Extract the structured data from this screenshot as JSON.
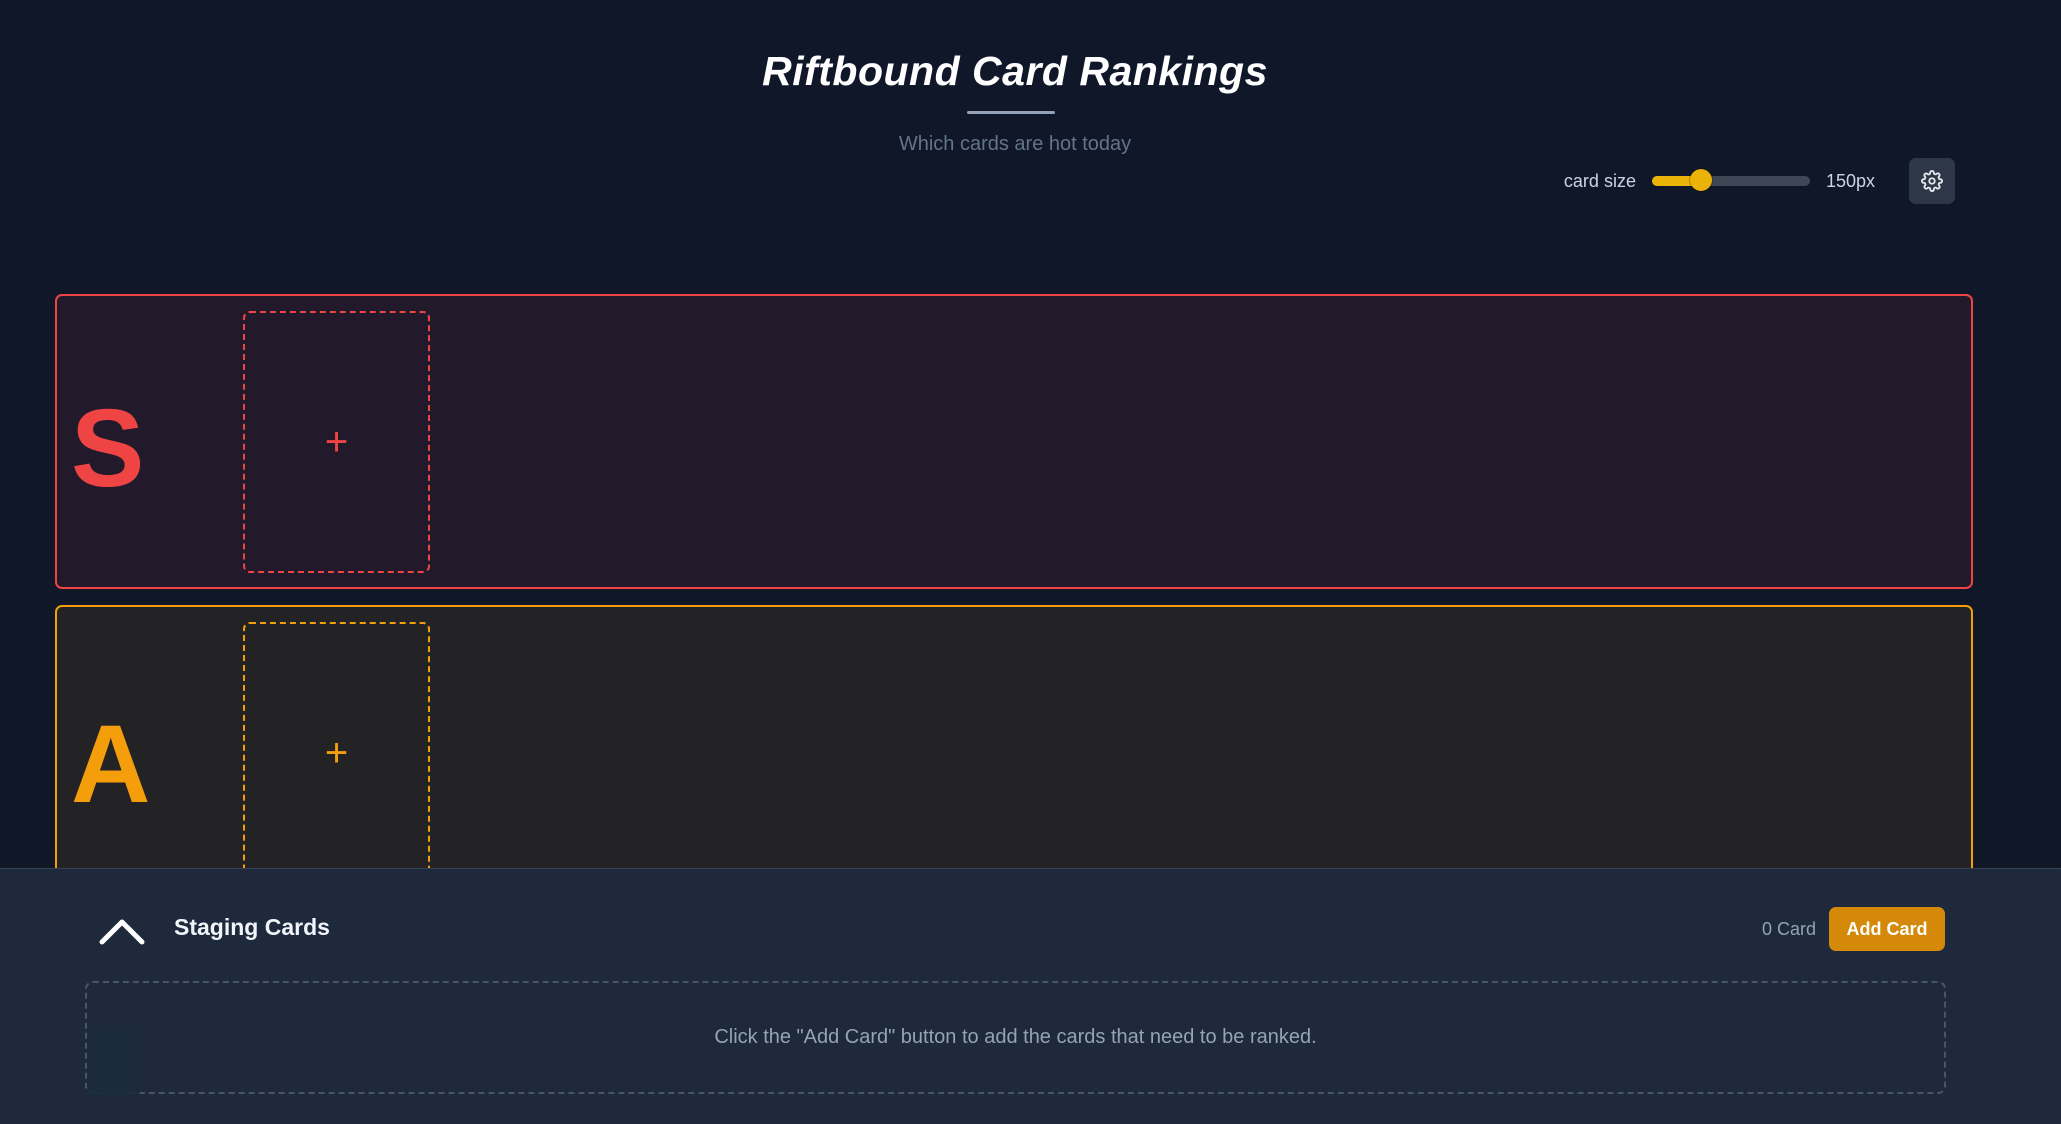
{
  "header": {
    "title": "Riftbound Card Rankings",
    "subtitle": "Which cards are hot today"
  },
  "size_control": {
    "label": "card size",
    "value_label": "150px",
    "slider_fraction": 0.31,
    "accent_color": "#eab308"
  },
  "settings": {
    "icon": "gear-icon"
  },
  "tiers": [
    {
      "label": "S",
      "color": "#ef4444",
      "add_glyph": "+"
    },
    {
      "label": "A",
      "color": "#f59e0b",
      "add_glyph": "+"
    }
  ],
  "staging": {
    "collapse_icon": "chevron-up-icon",
    "title": "Staging Cards",
    "count_label": "0 Card",
    "add_button_label": "Add Card",
    "add_button_color": "#d48a08",
    "empty_message": "Click the \"Add Card\" button to add the cards that need to be ranked."
  }
}
